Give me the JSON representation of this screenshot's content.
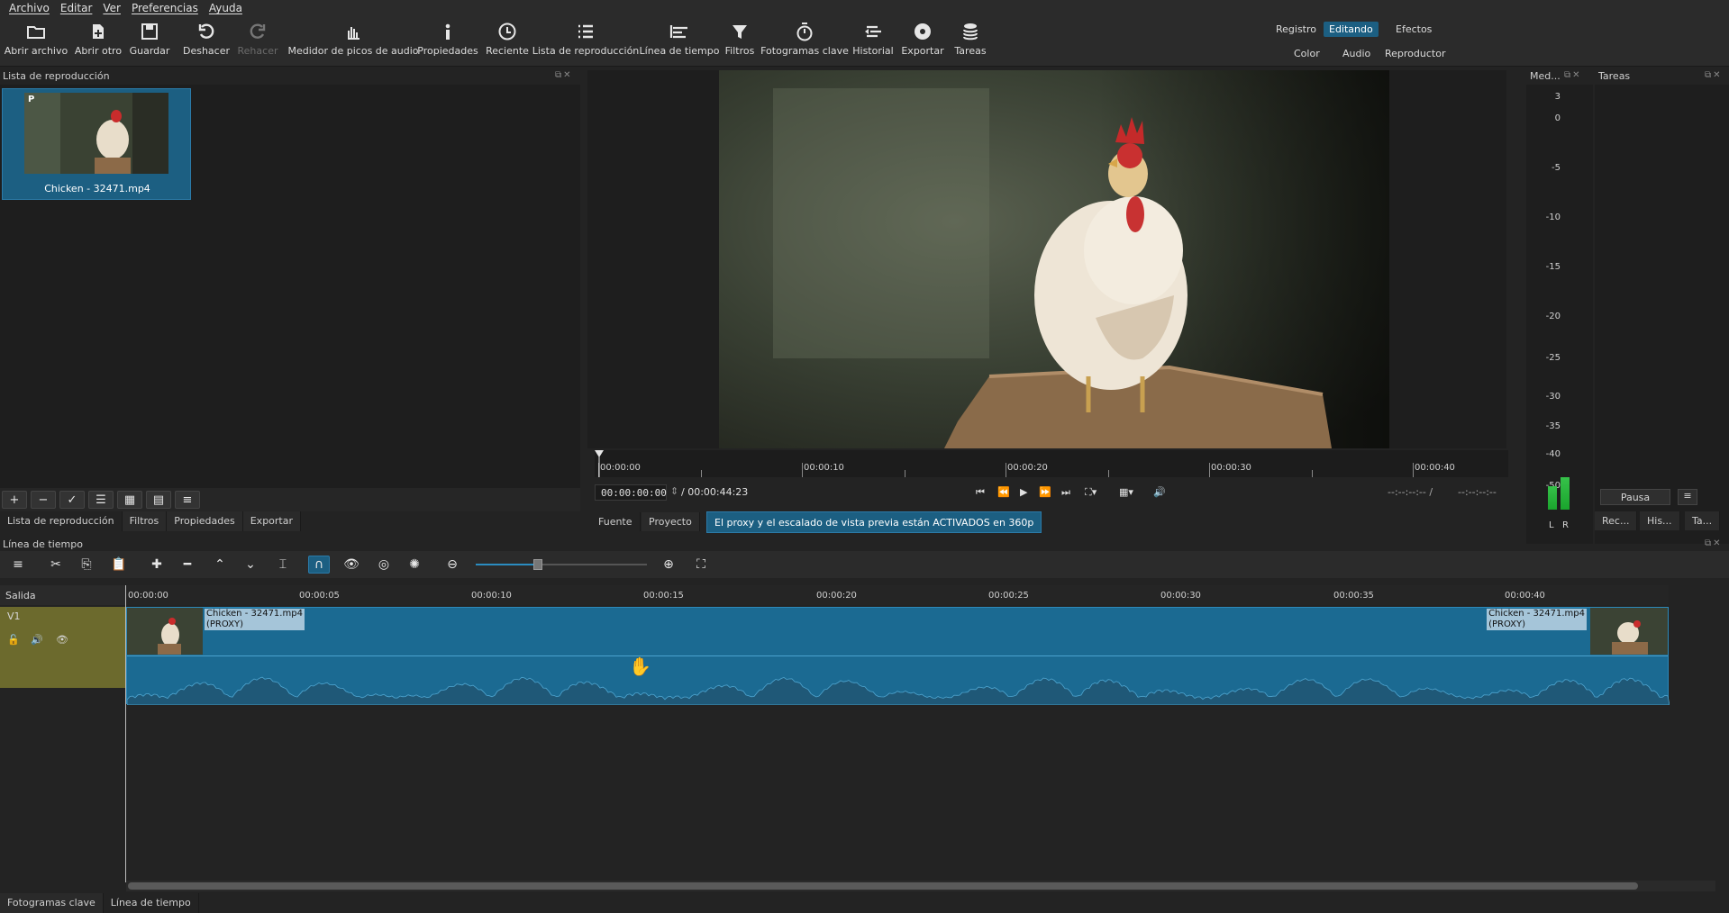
{
  "menu": [
    "Archivo",
    "Editar",
    "Ver",
    "Preferencias",
    "Ayuda"
  ],
  "toolbar": [
    {
      "label": "Abrir archivo",
      "icon": "folder-icon"
    },
    {
      "label": "Abrir otro",
      "icon": "open-other-icon"
    },
    {
      "label": "Guardar",
      "icon": "save-icon"
    },
    {
      "label": "Deshacer",
      "icon": "undo-icon"
    },
    {
      "label": "Rehacer",
      "icon": "redo-icon"
    },
    {
      "label": "Medidor de picos de audio",
      "icon": "audio-meter-icon"
    },
    {
      "label": "Propiedades",
      "icon": "info-icon"
    },
    {
      "label": "Reciente",
      "icon": "clock-icon"
    },
    {
      "label": "Lista de reproducción",
      "icon": "list-icon"
    },
    {
      "label": "Línea de tiempo",
      "icon": "timeline-icon"
    },
    {
      "label": "Filtros",
      "icon": "filter-icon"
    },
    {
      "label": "Fotogramas clave",
      "icon": "stopwatch-icon"
    },
    {
      "label": "Historial",
      "icon": "history-icon"
    },
    {
      "label": "Exportar",
      "icon": "export-icon"
    },
    {
      "label": "Tareas",
      "icon": "jobs-icon"
    }
  ],
  "layouts": {
    "registro": "Registro",
    "editando": "Editando",
    "efectos": "Efectos",
    "color": "Color",
    "audio": "Audio",
    "reproductor": "Reproductor"
  },
  "playlist": {
    "title": "Lista de reproducción",
    "clip_name": "Chicken - 32471.mp4",
    "proxy_badge": "P",
    "tabs": [
      "Lista de reproducción",
      "Filtros",
      "Propiedades",
      "Exportar"
    ]
  },
  "viewer": {
    "ruler_labels": [
      "00:00:00",
      "00:00:10",
      "00:00:20",
      "00:00:30",
      "00:00:40"
    ],
    "timecode": "00:00:00:00",
    "duration": "/ 00:00:44:23",
    "in_out_a": "--:--:--:-- /",
    "in_out_b": "--:--:--:--",
    "tabs": [
      "Fuente",
      "Proyecto"
    ],
    "proxy_notice": "El proxy y el escalado de vista previa están ACTIVADOS en 360p"
  },
  "meter": {
    "title": "Med...",
    "scale": [
      "3",
      "0",
      "-5",
      "-10",
      "-15",
      "-20",
      "-25",
      "-30",
      "-35",
      "-40",
      "-50"
    ],
    "left": "L",
    "right": "R"
  },
  "jobs": {
    "title": "Tareas",
    "pause": "Pausa",
    "tabs": [
      "Rec...",
      "His...",
      "Ta..."
    ]
  },
  "timeline": {
    "title": "Línea de tiempo",
    "output_label": "Salida",
    "track_name": "V1",
    "ruler_labels": [
      "00:00:00",
      "00:00:05",
      "00:00:10",
      "00:00:15",
      "00:00:20",
      "00:00:25",
      "00:00:30",
      "00:00:35",
      "00:00:40"
    ],
    "clip_label_line1": "Chicken - 32471.mp4",
    "clip_label_line2": "(PROXY)"
  },
  "bottom_tabs": [
    "Fotogramas clave",
    "Línea de tiempo"
  ],
  "colors": {
    "accent": "#1c5f82",
    "track_head": "#6c6a2d",
    "clip": "#1b6a92"
  }
}
